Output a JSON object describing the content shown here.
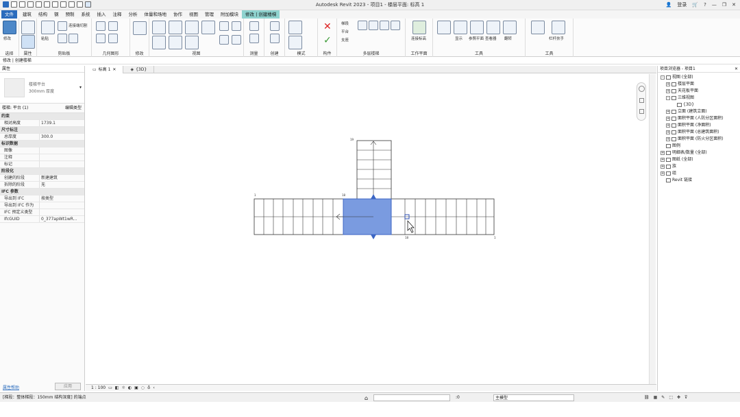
{
  "app": {
    "title": "Autodesk Revit 2023 - 项目1 - 楼层平面: 标高 1",
    "user": "登录",
    "help": "?"
  },
  "menu": {
    "tabs": [
      "文件",
      "建筑",
      "结构",
      "钢",
      "预制",
      "系统",
      "插入",
      "注释",
      "分析",
      "体量和场地",
      "协作",
      "视图",
      "管理",
      "附加模块",
      "修改 | 创建楼梯"
    ]
  },
  "ribbon": {
    "groups": [
      "选择",
      "属性",
      "剪贴板",
      "几何图形",
      "修改",
      "视图",
      "测量",
      "创建",
      "模式",
      "构件",
      "多层楼梯",
      "工作平面",
      "工具"
    ],
    "modify_label": "修改",
    "properties_label": "属性",
    "paste_label": "粘贴",
    "join_label": "连接端切割",
    "component_items": [
      "梯段",
      "平台",
      "支座"
    ],
    "connect_levels": "连接标高",
    "show_label": "显示",
    "ref_plane_label": "参照平面",
    "viewer_label": "查看器",
    "flip_label": "翻转",
    "railing_label": "栏杆扶手"
  },
  "context": {
    "text": "修改 | 创建楼梯"
  },
  "properties": {
    "header": "属性",
    "type_family": "楼梯平台",
    "type_name": "300mm 厚度",
    "selector": "楼梯: 平台 (1)",
    "edit_type": "编辑类型",
    "rows": [
      {
        "cat": true,
        "k": "约束"
      },
      {
        "k": "相对高度",
        "v": "1739.1"
      },
      {
        "cat": true,
        "k": "尺寸标注"
      },
      {
        "k": "总厚度",
        "v": "300.0"
      },
      {
        "cat": true,
        "k": "标识数据"
      },
      {
        "k": "图像",
        "v": ""
      },
      {
        "k": "注释",
        "v": ""
      },
      {
        "k": "标记",
        "v": ""
      },
      {
        "cat": true,
        "k": "阶段化"
      },
      {
        "k": "创建的阶段",
        "v": "新建建筑"
      },
      {
        "k": "拆除的阶段",
        "v": "无"
      },
      {
        "cat": true,
        "k": "IFC 参数"
      },
      {
        "k": "导出到 IFC",
        "v": "按类型"
      },
      {
        "k": "导出到 IFC 作为",
        "v": ""
      },
      {
        "k": "IFC 预定义类型",
        "v": ""
      },
      {
        "k": "IfcGUID",
        "v": "0_377apWt1wR..."
      }
    ],
    "help_link": "属性帮助",
    "apply": "应用"
  },
  "viewtabs": [
    "标高 1",
    "{3D}"
  ],
  "viewcontrol": {
    "scale": "1 : 100"
  },
  "browser": {
    "header": "项目浏览器 - 项目1",
    "nodes": [
      {
        "depth": 0,
        "tw": "-",
        "label": "视图 (全部)"
      },
      {
        "depth": 1,
        "tw": "+",
        "label": "楼层平面"
      },
      {
        "depth": 1,
        "tw": "+",
        "label": "天花板平面"
      },
      {
        "depth": 1,
        "tw": "-",
        "label": "三维视图"
      },
      {
        "depth": 2,
        "tw": "",
        "label": "{3D}"
      },
      {
        "depth": 1,
        "tw": "+",
        "label": "立面 (建筑立面)"
      },
      {
        "depth": 1,
        "tw": "+",
        "label": "面积平面 (人防分区面积)"
      },
      {
        "depth": 1,
        "tw": "+",
        "label": "面积平面 (净面积)"
      },
      {
        "depth": 1,
        "tw": "+",
        "label": "面积平面 (总建筑面积)"
      },
      {
        "depth": 1,
        "tw": "+",
        "label": "面积平面 (防火分区面积)"
      },
      {
        "depth": 0,
        "tw": "",
        "label": "图例"
      },
      {
        "depth": 0,
        "tw": "+",
        "label": "明细表/数量 (全部)"
      },
      {
        "depth": 0,
        "tw": "+",
        "label": "图纸 (全部)"
      },
      {
        "depth": 0,
        "tw": "+",
        "label": "族"
      },
      {
        "depth": 0,
        "tw": "+",
        "label": "组"
      },
      {
        "depth": 0,
        "tw": "",
        "label": "Revit 链接"
      }
    ]
  },
  "status": {
    "message": "[梯段：整体梯段：150mm 结构深度] 的端点",
    "coord": ":0",
    "model": "主模型"
  },
  "colors": {
    "accent": "#2a6bbd",
    "context_tab": "#8fd3cf",
    "landing": "#7a9be0"
  }
}
